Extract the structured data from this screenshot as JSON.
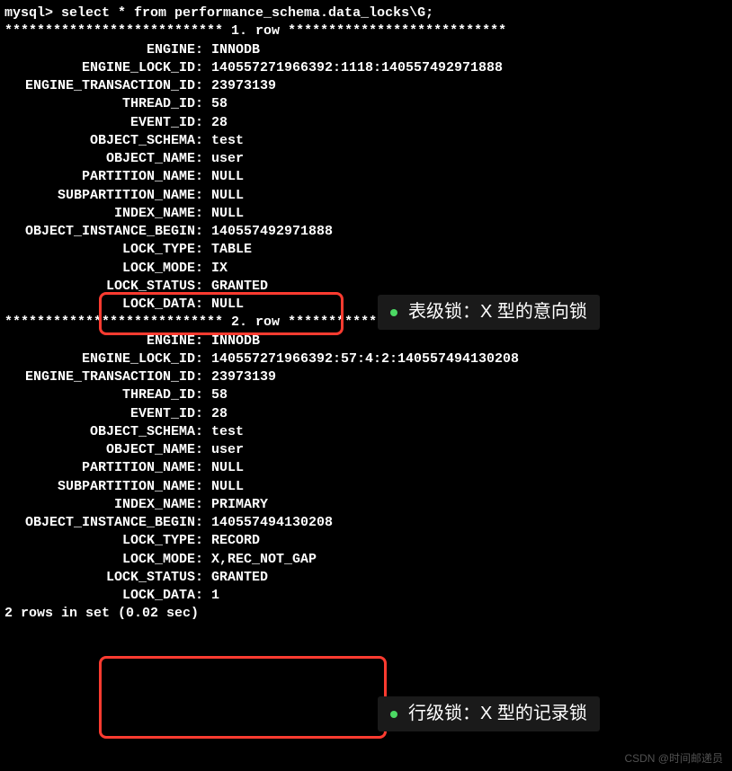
{
  "prompt": "mysql> select * from performance_schema.data_locks\\G;",
  "row_sep_prefix": "*************************** ",
  "row_sep_suffix": " ***************************",
  "row1_label": "1. row",
  "row2_label": "2. row",
  "row1": {
    "ENGINE": "INNODB",
    "ENGINE_LOCK_ID": "140557271966392:1118:140557492971888",
    "ENGINE_TRANSACTION_ID": "23973139",
    "THREAD_ID": "58",
    "EVENT_ID": "28",
    "OBJECT_SCHEMA": "test",
    "OBJECT_NAME": "user",
    "PARTITION_NAME": "NULL",
    "SUBPARTITION_NAME": "NULL",
    "INDEX_NAME": "NULL",
    "OBJECT_INSTANCE_BEGIN": "140557492971888",
    "LOCK_TYPE": "TABLE",
    "LOCK_MODE": "IX",
    "LOCK_STATUS": "GRANTED",
    "LOCK_DATA": "NULL"
  },
  "row2": {
    "ENGINE": "INNODB",
    "ENGINE_LOCK_ID": "140557271966392:57:4:2:140557494130208",
    "ENGINE_TRANSACTION_ID": "23973139",
    "THREAD_ID": "58",
    "EVENT_ID": "28",
    "OBJECT_SCHEMA": "test",
    "OBJECT_NAME": "user",
    "PARTITION_NAME": "NULL",
    "SUBPARTITION_NAME": "NULL",
    "INDEX_NAME": "PRIMARY",
    "OBJECT_INSTANCE_BEGIN": "140557494130208",
    "LOCK_TYPE": "RECORD",
    "LOCK_MODE": "X,REC_NOT_GAP",
    "LOCK_STATUS": "GRANTED",
    "LOCK_DATA": "1"
  },
  "footer": "2 rows in set (0.02 sec)",
  "annotation1": "表级锁：X 型的意向锁",
  "annotation2": "行级锁：X 型的记录锁",
  "watermark": "CSDN @时间邮递员",
  "labels": {
    "ENGINE": "               ENGINE: ",
    "ENGINE_LOCK_ID": "       ENGINE_LOCK_ID: ",
    "ENGINE_TRANSACTION_ID": "ENGINE_TRANSACTION_ID: ",
    "THREAD_ID": "            THREAD_ID: ",
    "EVENT_ID": "             EVENT_ID: ",
    "OBJECT_SCHEMA": "        OBJECT_SCHEMA: ",
    "OBJECT_NAME": "          OBJECT_NAME: ",
    "PARTITION_NAME": "       PARTITION_NAME: ",
    "SUBPARTITION_NAME": "    SUBPARTITION_NAME: ",
    "INDEX_NAME": "           INDEX_NAME: ",
    "OBJECT_INSTANCE_BEGIN": "OBJECT_INSTANCE_BEGIN: ",
    "LOCK_TYPE": "            LOCK_TYPE: ",
    "LOCK_MODE": "            LOCK_MODE: ",
    "LOCK_STATUS": "          LOCK_STATUS: ",
    "LOCK_DATA": "            LOCK_DATA: "
  }
}
